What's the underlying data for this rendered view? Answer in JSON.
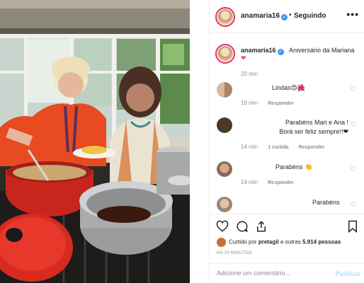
{
  "header": {
    "username": "anamaria16",
    "separator": "•",
    "follow_label": "Seguindo",
    "more_label": "•••"
  },
  "caption": {
    "username": "anamaria16",
    "text": "Aniversário da Mariana",
    "emoji": "❤",
    "time": "20 min"
  },
  "comments": [
    {
      "text": "Lindas😍🌺",
      "time": "19 min",
      "reply_label": "Responder",
      "likes": ""
    },
    {
      "text": "Parabéns Mari e Ana ! Borá ser feliz sempre!!❤",
      "time": "14 min",
      "likes": "1 curtida",
      "reply_label": "Responder"
    },
    {
      "text": "Parabéns 👏",
      "time": "14 min",
      "reply_label": "Responder",
      "likes": ""
    },
    {
      "text": "Parabéns",
      "time": "",
      "reply_label": "",
      "likes": ""
    }
  ],
  "actions": {
    "liked_prefix": "Curtido por",
    "liked_user": "pretagil",
    "liked_mid": "e outras",
    "liked_count": "5.914 pessoas",
    "post_time": "HÁ 20 MINUTOS"
  },
  "add_comment": {
    "placeholder": "Adicione um comentário...",
    "publish_label": "Publicar"
  },
  "colors": {
    "verified": "#3897f0",
    "heart": "#ed4956",
    "publish_disabled": "#b2dffc",
    "pot_red": "#c8261d"
  },
  "icons": [
    "verified-icon",
    "heart-icon",
    "comment-icon",
    "share-icon",
    "bookmark-icon"
  ]
}
